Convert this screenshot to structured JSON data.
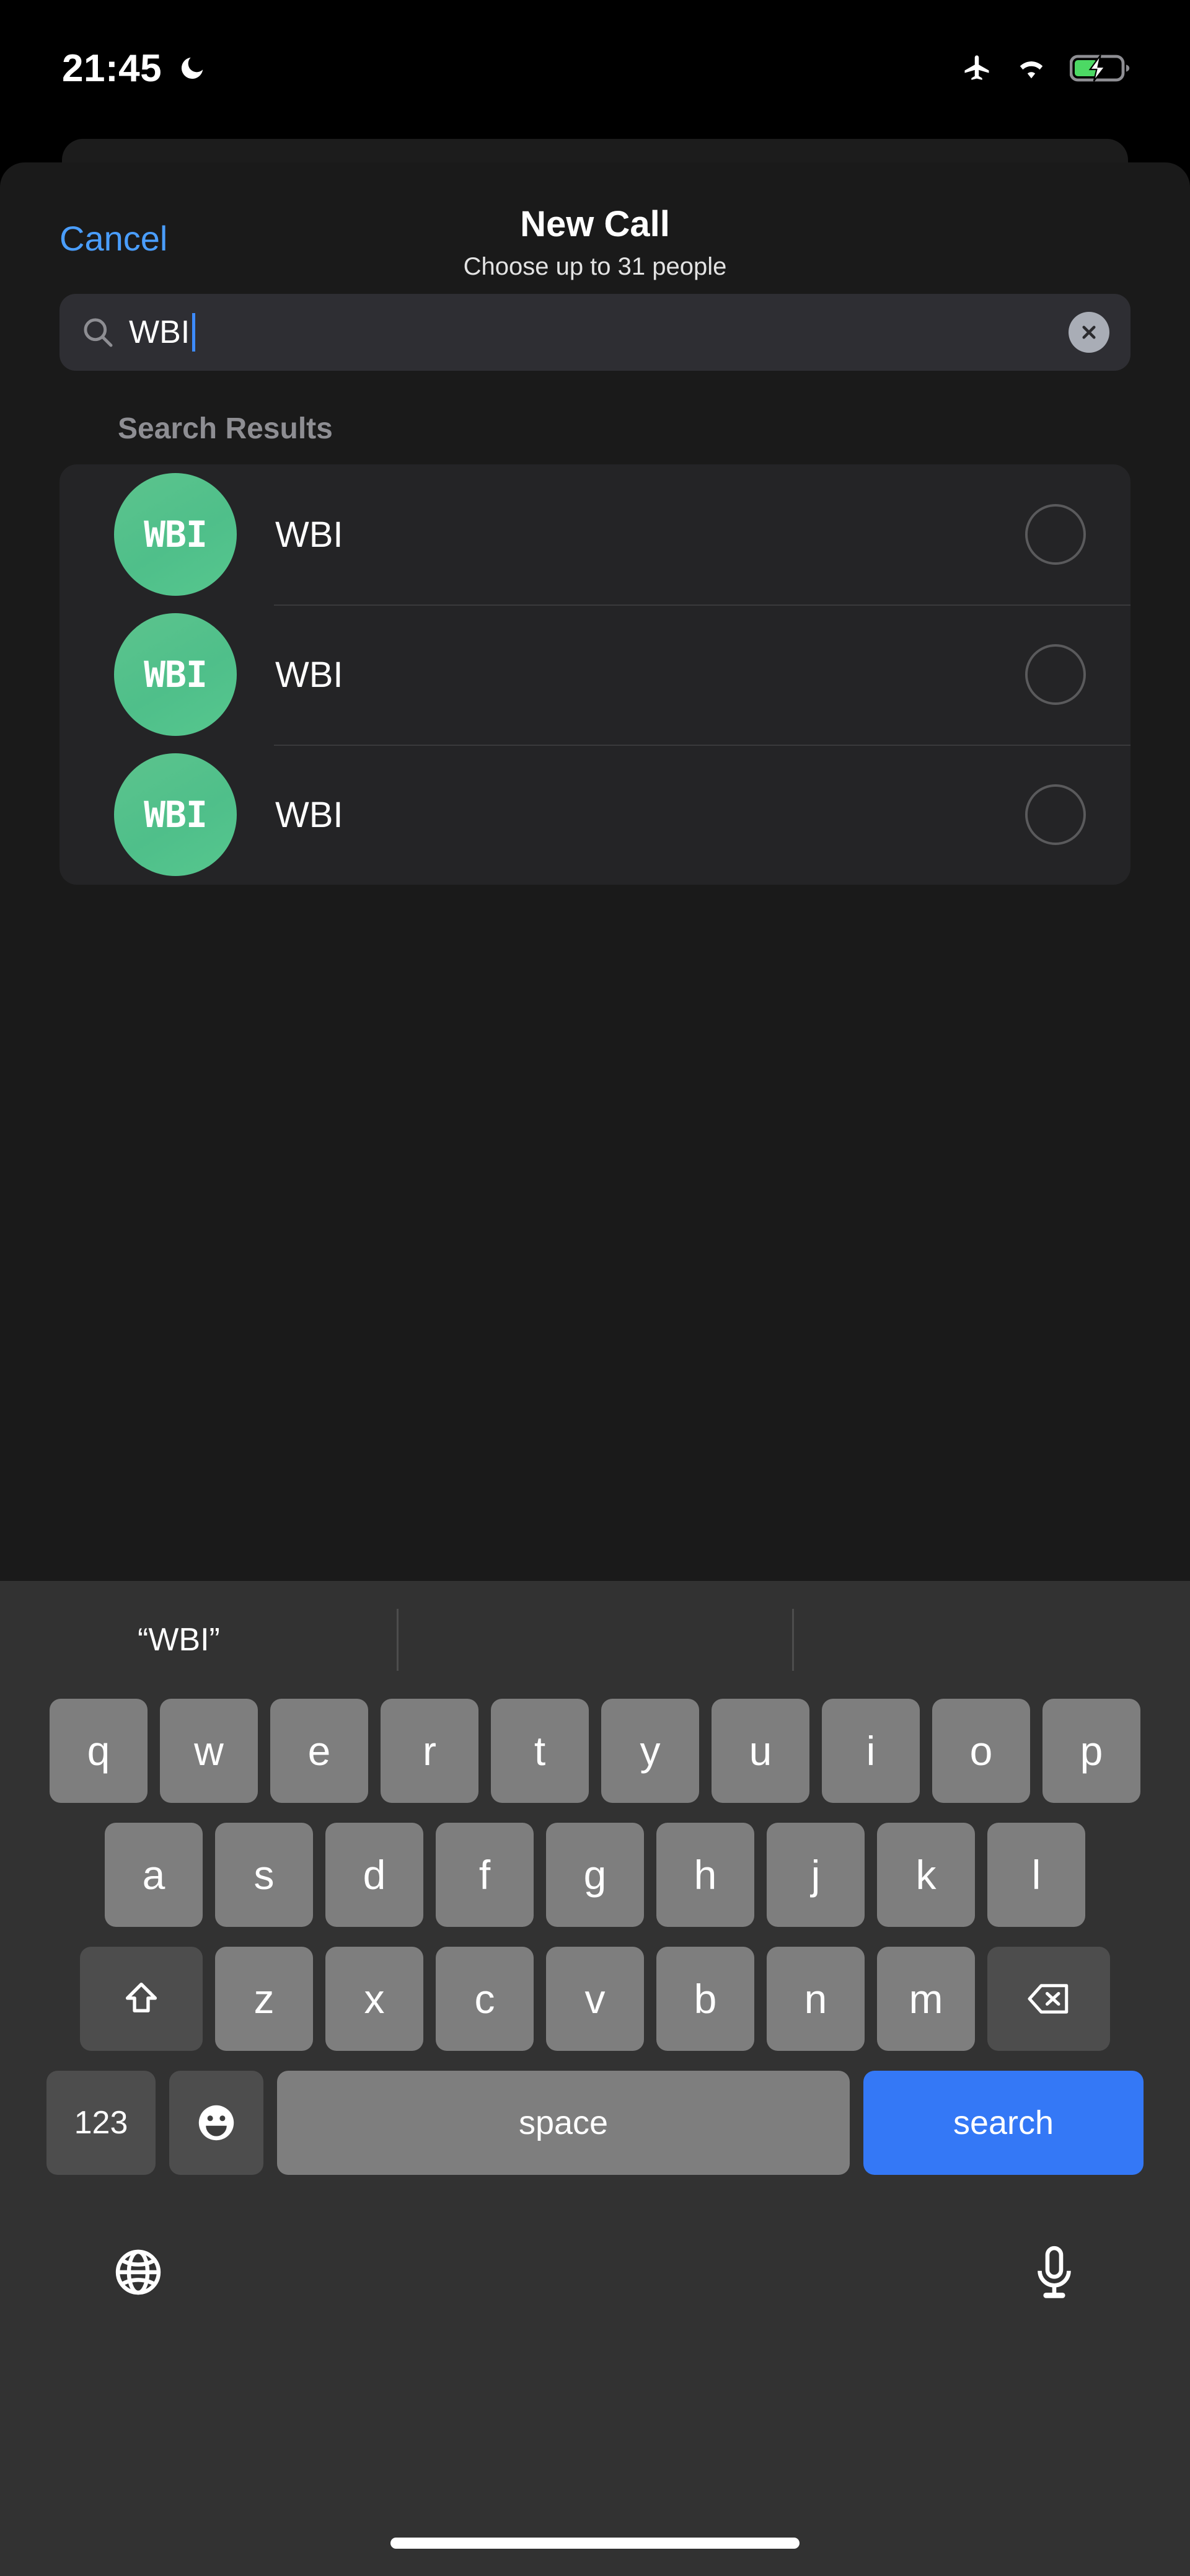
{
  "status_bar": {
    "time": "21:45",
    "do_not_disturb_icon": "moon-icon",
    "airplane_icon": "airplane-mode-icon",
    "wifi_icon": "wifi-icon",
    "battery_icon": "battery-charging-icon",
    "battery_color": "#4cd964",
    "battery_level_percent": 50
  },
  "modal": {
    "cancel_label": "Cancel",
    "title": "New Call",
    "subtitle": "Choose up to 31 people"
  },
  "search": {
    "value": "WBI",
    "placeholder": "Search",
    "icon": "search-icon",
    "clear_icon": "clear-circle-icon",
    "caret_color": "#3d8bff"
  },
  "results": {
    "section_label": "Search Results",
    "rows": [
      {
        "initials": "WBI",
        "name": "WBI",
        "selected": false,
        "avatar_color": "#53c48d"
      },
      {
        "initials": "WBI",
        "name": "WBI",
        "selected": false,
        "avatar_color": "#53c48d"
      },
      {
        "initials": "WBI",
        "name": "WBI",
        "selected": false,
        "avatar_color": "#53c48d"
      }
    ]
  },
  "keyboard": {
    "suggestions": [
      "“WBI”",
      "",
      ""
    ],
    "row1": [
      "q",
      "w",
      "e",
      "r",
      "t",
      "y",
      "u",
      "i",
      "o",
      "p"
    ],
    "row2": [
      "a",
      "s",
      "d",
      "f",
      "g",
      "h",
      "j",
      "k",
      "l"
    ],
    "row3": [
      "z",
      "x",
      "c",
      "v",
      "b",
      "n",
      "m"
    ],
    "shift_label": "shift-icon",
    "backspace_label": "backspace-icon",
    "numeric_label": "123",
    "emoji_label": "emoji-icon",
    "space_label": "space",
    "action_label": "search",
    "globe_label": "globe-icon",
    "mic_label": "microphone-icon",
    "action_key_color": "#3478f6"
  }
}
